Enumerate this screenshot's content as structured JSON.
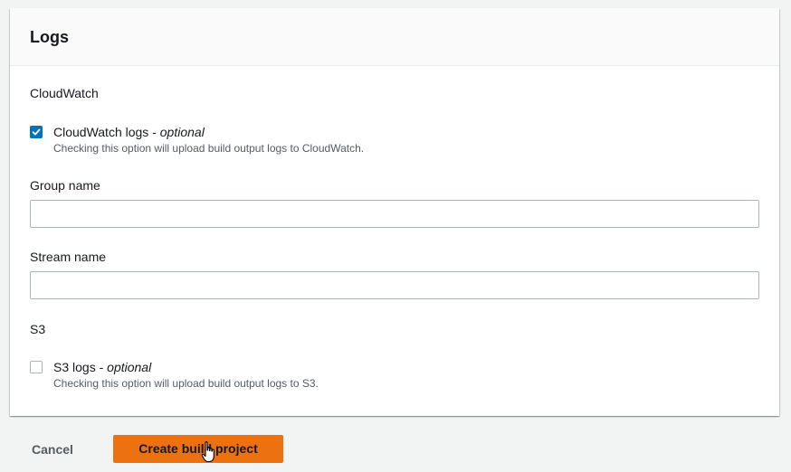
{
  "logs_panel": {
    "title": "Logs",
    "cloudwatch": {
      "section_label": "CloudWatch",
      "checkbox": {
        "label": "CloudWatch logs",
        "separator": " - ",
        "optional": "optional",
        "description": "Checking this option will upload build output logs to CloudWatch.",
        "checked": true
      },
      "group_name": {
        "label": "Group name",
        "value": ""
      },
      "stream_name": {
        "label": "Stream name",
        "value": ""
      }
    },
    "s3": {
      "section_label": "S3",
      "checkbox": {
        "label": "S3 logs",
        "separator": " - ",
        "optional": "optional",
        "description": "Checking this option will upload build output logs to S3.",
        "checked": false
      }
    }
  },
  "footer": {
    "cancel_label": "Cancel",
    "create_label": "Create build project"
  },
  "colors": {
    "accent": "#0073bb",
    "primary_button": "#ec7211",
    "page_background": "#f2f3f3"
  },
  "icons": {
    "checkbox_check": "check-icon",
    "cursor": "hand-pointer-icon"
  }
}
